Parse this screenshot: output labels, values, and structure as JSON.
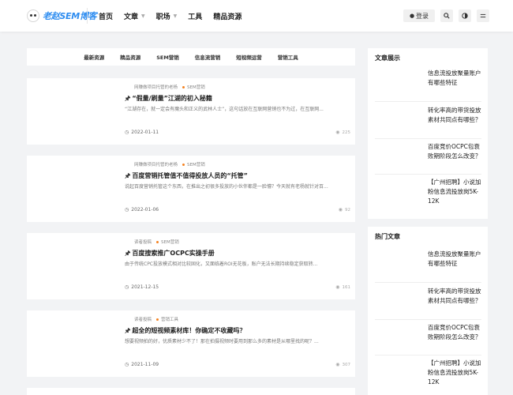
{
  "header": {
    "logo_text": "老赵SEM博客",
    "nav": [
      {
        "label": "首页",
        "has_dropdown": false
      },
      {
        "label": "文章",
        "has_dropdown": true
      },
      {
        "label": "职场",
        "has_dropdown": true
      },
      {
        "label": "工具",
        "has_dropdown": false
      },
      {
        "label": "精品资源",
        "has_dropdown": false
      }
    ],
    "login_label": "登录",
    "icons": [
      "search-icon",
      "theme-toggle-icon",
      "menu-icon"
    ]
  },
  "categories": [
    "最新资源",
    "精品资源",
    "SEM营销",
    "信息流营销",
    "短视频运营",
    "营销工具"
  ],
  "posts": [
    {
      "meta_author": "网赚做项目托管的老杨",
      "meta_category": "SEM营销",
      "title": "“假量/刷量”江湖的初入秘籍",
      "excerpt": "“江湖存在，就一定会有魔头和正义的武林人士”，这句话放在互联网营销也不为过，在互联网...",
      "date": "2022-01-11",
      "views": "225"
    },
    {
      "meta_author": "网赚做项目托管的老杨",
      "meta_category": "SEM营销",
      "title": "百度营销托管值不值得投放人员的“托管”",
      "excerpt": "说起百度营销托管这个东西，在推出之初很多投放的小伙伴都是一脸懵？今天就有老杨就针对百...",
      "date": "2022-01-06",
      "views": "92"
    },
    {
      "meta_author": "读者投稿",
      "meta_category": "SEM营销",
      "title": "百度搜索推广OCPC实操手册",
      "excerpt": "由于传统CPC投放模式相对比较固化，又面临着ROI无花板，账户无法长期持续稳定获取转...",
      "date": "2021-12-15",
      "views": "161"
    },
    {
      "meta_author": "读者投稿",
      "meta_category": "营销工具",
      "title": "超全的短视频素材库！你确定不收藏吗？",
      "excerpt": "想要视频拍的好，优质素材少不了！那在拍摄视频时要用到那么多的素材是从哪里找的呢？...",
      "date": "2021-11-09",
      "views": "307"
    }
  ],
  "sidebar": {
    "article_widget": {
      "title": "文章展示",
      "items": [
        "信息流投放聚量账户有哪些特征",
        "转化率高的带货投放素材共同点有哪些？",
        "百度竞价OCPC包衰败期阶段怎么改变？",
        "【广州招聘】小说加粉信息流投放岗5K-12K"
      ]
    },
    "hot_widget": {
      "title": "热门文章",
      "items": [
        "信息流投放聚量账户有哪些特征",
        "转化率高的带货投放素材共同点有哪些？",
        "百度竞价OCPC包衰败期阶段怎么改变？",
        "【广州招聘】小说加粉信息流投放岗5K-12K"
      ]
    }
  },
  "colors": {
    "brand": "#2d8cf0",
    "category_dot": "#f58220",
    "background": "#f2f3f5"
  }
}
